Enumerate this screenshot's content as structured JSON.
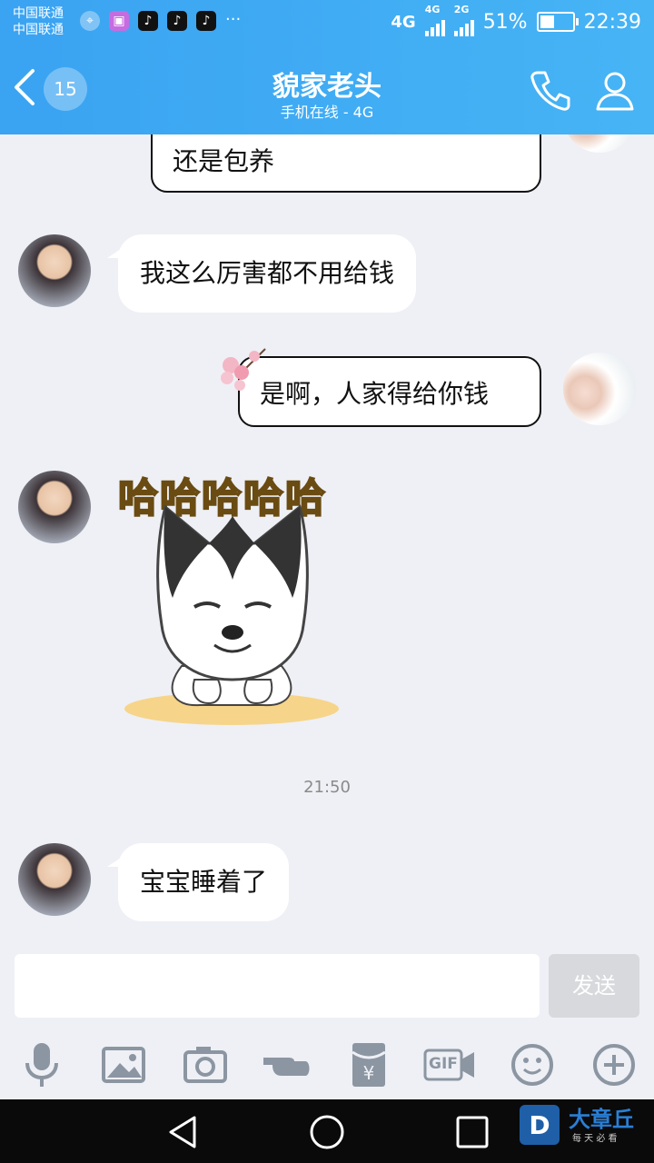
{
  "status_bar": {
    "carrier_1": "中国联通",
    "carrier_2": "中国联通",
    "net_4g": "4G",
    "net_4g_small": "4G",
    "net_2g": "2G",
    "battery_percent": "51%",
    "battery_level": 0.51,
    "time": "22:39",
    "more": "···"
  },
  "header": {
    "unread_count": "15",
    "title": "貌家老头",
    "subtitle": "手机在线 - 4G"
  },
  "messages": {
    "top_partial": "还是包养",
    "m1": "我这么厉害都不用给钱",
    "m2": "是啊，人家得给你钱",
    "sticker_caption": "哈哈哈哈哈",
    "timestamp": "21:50",
    "m3": "宝宝睡着了"
  },
  "input": {
    "send_label": "发送"
  },
  "toolbar": {
    "gif_label": "GIF"
  },
  "watermark": {
    "brand": "大章丘",
    "slogan": "每 天 必 看"
  },
  "colors": {
    "header_blue": "#3aa3f2",
    "chat_bg": "#eef0f5",
    "send_disabled": "#d7d9dd"
  }
}
